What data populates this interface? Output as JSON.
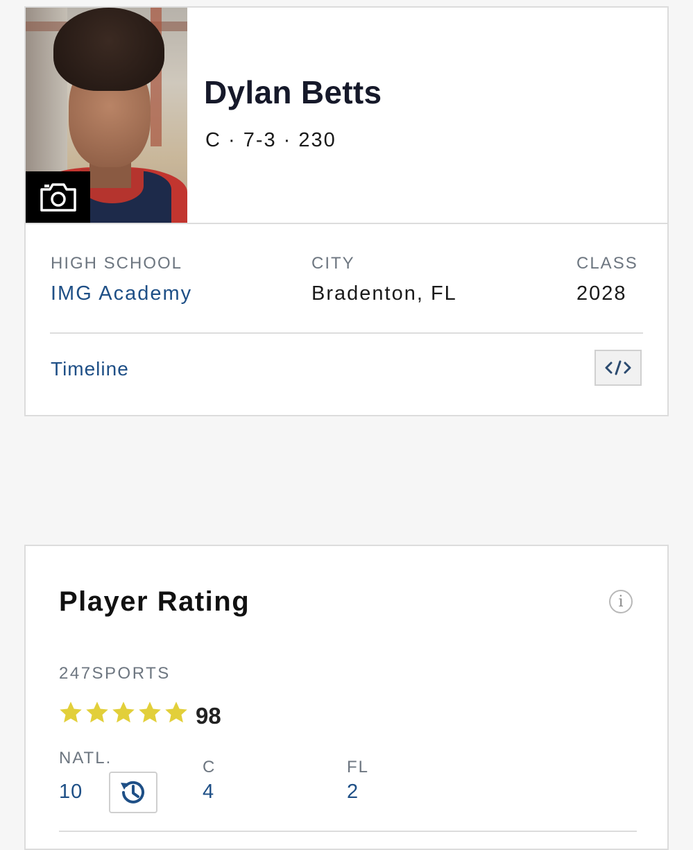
{
  "player": {
    "name": "Dylan Betts",
    "meta": "C · 7-3 · 230"
  },
  "details": {
    "high_school_label": "HIGH SCHOOL",
    "high_school": "IMG Academy",
    "city_label": "CITY",
    "city": "Bradenton, FL",
    "class_label": "CLASS",
    "class": "2028"
  },
  "links": {
    "timeline": "Timeline",
    "embed_icon": "code-embed-icon"
  },
  "rating": {
    "title": "Player Rating",
    "info_symbol": "i",
    "source": "247SPORTS",
    "stars": 5,
    "score": "98",
    "star_color": "#e2cf3a",
    "ranks": {
      "natl_label": "NATL.",
      "natl_value": "10",
      "position_label": "C",
      "position_value": "4",
      "state_label": "FL",
      "state_value": "2"
    }
  },
  "colors": {
    "link": "#1e4f86",
    "label": "#6d7680",
    "border": "#dcdcdc",
    "background": "#f6f6f6"
  }
}
